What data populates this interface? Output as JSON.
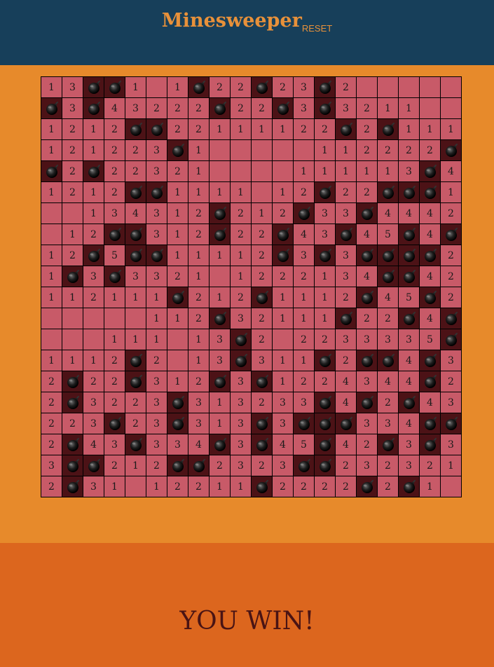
{
  "header": {
    "title": "Minesweeper",
    "reset_label": "RESET"
  },
  "status": "YOU WIN!",
  "colors": {
    "header_bg": "#173f5a",
    "body_bg": "#e78a2b",
    "footer_bg": "#dc661e",
    "cell": "#c85a68",
    "mine_cell": "#4c1216",
    "accent": "#e8913a",
    "status_text": "#4a1414"
  },
  "board": {
    "rows": 20,
    "cols": 20,
    "mine_icon": "bomb-icon",
    "grid": [
      "13**1 1*22*23*2     ",
      "*3*43222*22*3*3211  ",
      "1212**22111122*2*111",
      "121223*1     112222*",
      "*2*22321    111113*42",
      "1212**1111 12*22***1",
      "  134312*212*33*4442",
      " 12**312*22*43*45*4*",
      "12*5**11112*3*3****2",
      "1*3*3321 1222134**42",
      "112111*212*1112*45*2",
      "     112*32111*22*4*3",
      "   111 13*2 2233335*3",
      "1112*2 13*311*2**4*3",
      "2*22*312*3*1224344*2",
      "2*3223*313233*4*2*43",
      "223*23*313*3***334**",
      "2*43*334*3*45*42*3*3",
      "3**212**2323**232321",
      "2*31 12211*2222*2*1 "
    ]
  }
}
